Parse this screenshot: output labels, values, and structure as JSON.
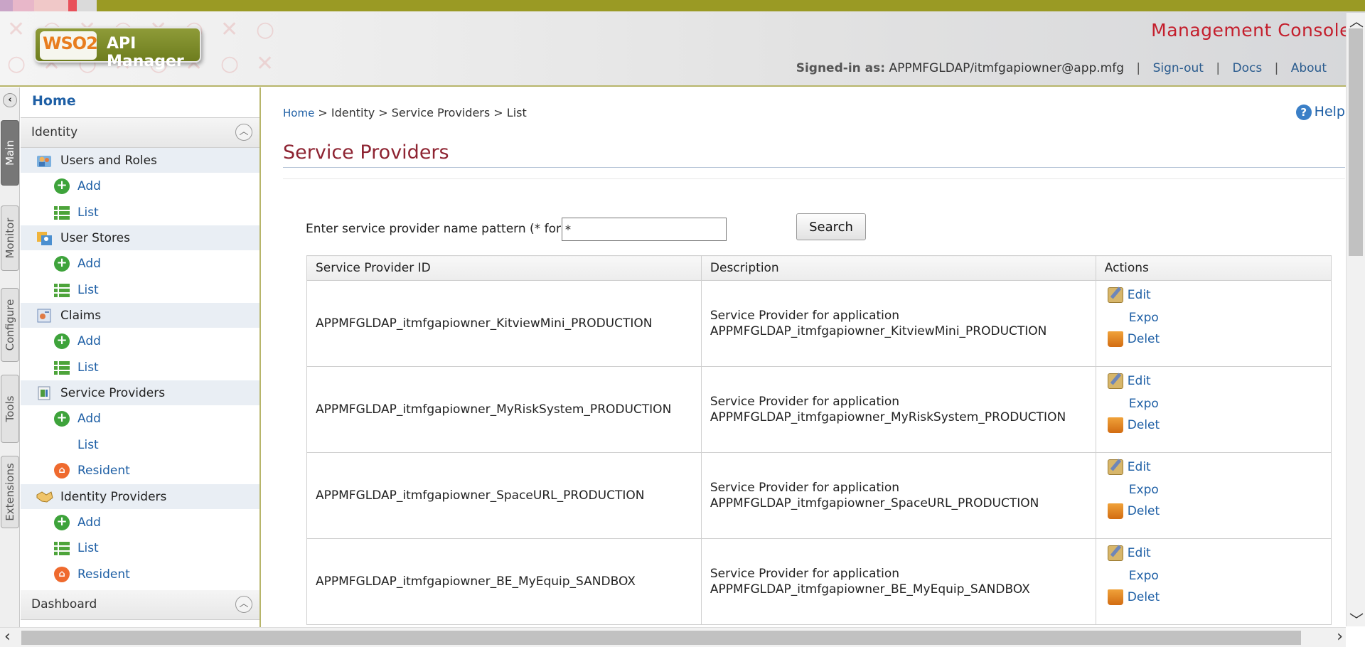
{
  "header": {
    "logo_mark": "WSO2",
    "product_name": "API Manager",
    "console_title": "Management Console",
    "signed_in_label": "Signed-in as:",
    "user": "APPMFGLDAP/itmfgapiowner@app.mfg",
    "links": {
      "signout": "Sign-out",
      "docs": "Docs",
      "about": "About"
    }
  },
  "vertical_tabs": [
    "Main",
    "Monitor",
    "Configure",
    "Tools",
    "Extensions"
  ],
  "sidebar": {
    "home": "Home",
    "section_identity": "Identity",
    "groups": {
      "users_roles": {
        "label": "Users and Roles",
        "add": "Add",
        "list": "List"
      },
      "user_stores": {
        "label": "User Stores",
        "add": "Add",
        "list": "List"
      },
      "claims": {
        "label": "Claims",
        "add": "Add",
        "list": "List"
      },
      "service_providers": {
        "label": "Service Providers",
        "add": "Add",
        "list": "List",
        "resident": "Resident"
      },
      "identity_providers": {
        "label": "Identity Providers",
        "add": "Add",
        "list": "List",
        "resident": "Resident"
      }
    },
    "section_dashboard": "Dashboard"
  },
  "breadcrumb": {
    "home": "Home",
    "rest": " > Identity > Service Providers > List"
  },
  "help": "Help",
  "page_title": "Service Providers",
  "search": {
    "label": "Enter service provider name pattern (* for all)",
    "value": "*",
    "button": "Search"
  },
  "table": {
    "headers": [
      "Service Provider ID",
      "Description",
      "Actions"
    ],
    "rows": [
      {
        "id": "APPMFGLDAP_itmfgapiowner_KitviewMini_PRODUCTION",
        "desc1": "Service Provider for application",
        "desc2": "APPMFGLDAP_itmfgapiowner_KitviewMini_PRODUCTION"
      },
      {
        "id": "APPMFGLDAP_itmfgapiowner_MyRiskSystem_PRODUCTION",
        "desc1": "Service Provider for application",
        "desc2": "APPMFGLDAP_itmfgapiowner_MyRiskSystem_PRODUCTION"
      },
      {
        "id": "APPMFGLDAP_itmfgapiowner_SpaceURL_PRODUCTION",
        "desc1": "Service Provider for application",
        "desc2": "APPMFGLDAP_itmfgapiowner_SpaceURL_PRODUCTION"
      },
      {
        "id": "APPMFGLDAP_itmfgapiowner_BE_MyEquip_SANDBOX",
        "desc1": "Service Provider for application",
        "desc2": "APPMFGLDAP_itmfgapiowner_BE_MyEquip_SANDBOX"
      }
    ],
    "actions": {
      "edit": "Edit",
      "export": "Expo",
      "delete": "Delet"
    }
  }
}
